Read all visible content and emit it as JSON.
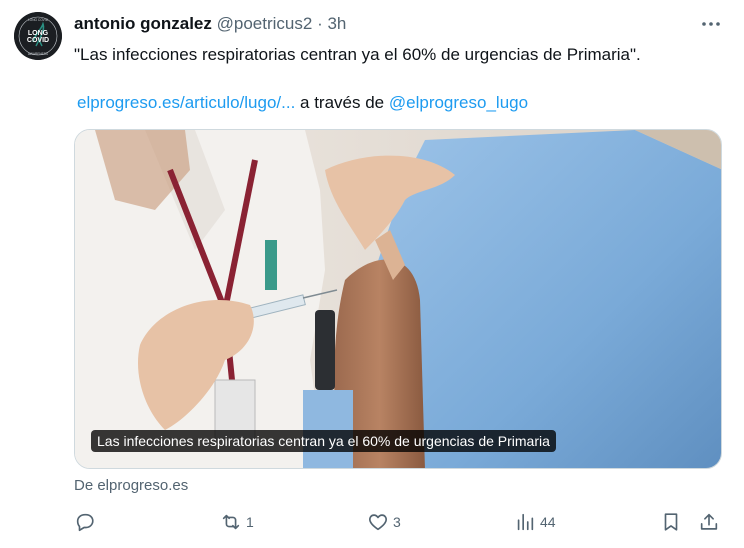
{
  "tweet": {
    "author_name": "antonio gonzalez",
    "handle": "@poetricus2",
    "separator": "·",
    "time": "3h",
    "text": "\"Las infecciones respiratorias centran ya el 60% de urgencias de Primaria\".",
    "link_url": "elprogreso.es/articulo/lugo/...",
    "via_text": "a través de",
    "via_account": "@elprogreso_lugo"
  },
  "avatar": {
    "top_text": "LONG COVID",
    "line1": "LONG",
    "line2": "COVID",
    "bottom_text": "AWARENESS"
  },
  "card": {
    "caption": "Las infecciones respiratorias centran ya el 60% de urgencias de Primaria",
    "source": "De elprogreso.es"
  },
  "actions": {
    "reply_count": "",
    "retweet_count": "1",
    "like_count": "3",
    "views_count": "44"
  },
  "icons": {
    "more": "more-horizontal-icon",
    "reply": "reply-icon",
    "retweet": "retweet-icon",
    "like": "heart-icon",
    "views": "views-icon",
    "bookmark": "bookmark-icon",
    "share": "share-icon"
  },
  "colors": {
    "link": "#1d9bf0",
    "secondary_text": "#536471",
    "text": "#0f1419"
  }
}
